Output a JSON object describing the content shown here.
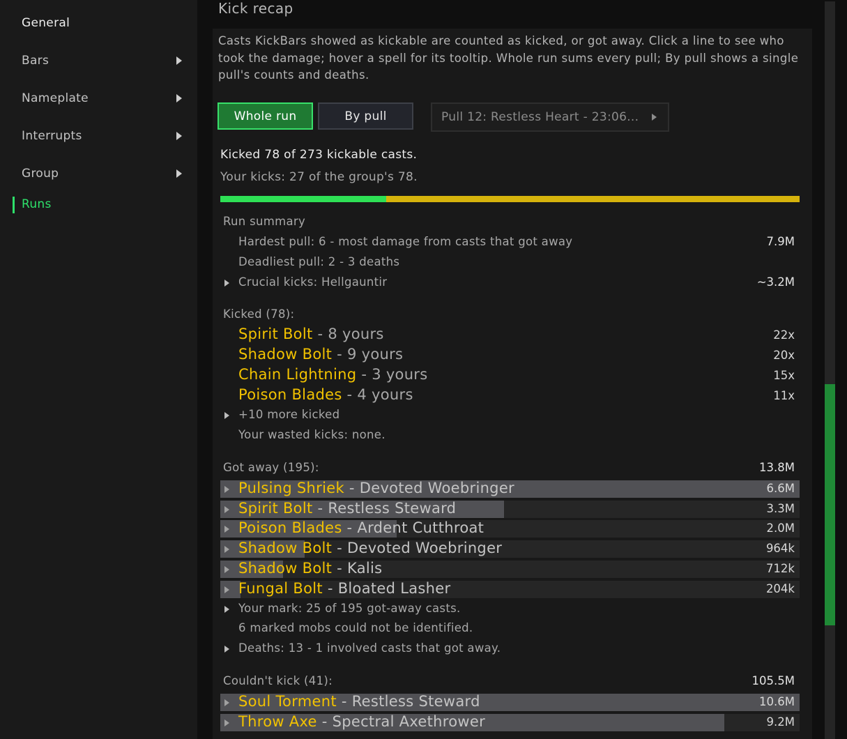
{
  "sidebar": {
    "items": [
      {
        "label": "General",
        "has_arrow": false
      },
      {
        "label": "Bars",
        "has_arrow": true
      },
      {
        "label": "Nameplate",
        "has_arrow": true
      },
      {
        "label": "Interrupts",
        "has_arrow": true
      },
      {
        "label": "Group",
        "has_arrow": true
      },
      {
        "label": "Runs",
        "has_arrow": false,
        "active": true
      }
    ]
  },
  "header": {
    "title": "Kick recap"
  },
  "description": "Casts KickBars showed as kickable are counted as kicked, or got away. Click a line to see who took the damage; hover a spell for its tooltip. Whole run sums every pull; By pull shows a single pull's counts and deaths.",
  "mode": {
    "whole_run": "Whole run",
    "by_pull": "By pull",
    "selected": "Whole run",
    "pull_select": "Pull 12: Restless Heart - 23:06..."
  },
  "totals": {
    "kicked_text": "Kicked 78 of 273 kickable casts.",
    "your_kicks_text": "Your kicks: 27 of the group's 78.",
    "progress_fraction": 0.286
  },
  "run_summary": {
    "title": "Run summary",
    "hardest": {
      "label": "Hardest pull: 6 - most damage from casts that got away",
      "value": "7.9M"
    },
    "deadliest": {
      "label": "Deadliest pull: 2 - 3 deaths"
    },
    "crucial": {
      "label": "Crucial kicks: Hellgauntir",
      "value": "~3.2M"
    }
  },
  "kicked": {
    "title": "Kicked (78):",
    "items": [
      {
        "spell": "Spirit Bolt",
        "detail": " - 8 yours",
        "count": "22x"
      },
      {
        "spell": "Shadow Bolt",
        "detail": " - 9 yours",
        "count": "20x"
      },
      {
        "spell": "Chain Lightning",
        "detail": " - 3 yours",
        "count": "15x"
      },
      {
        "spell": "Poison Blades",
        "detail": " - 4 yours",
        "count": "11x"
      }
    ],
    "more": "+10 more kicked",
    "wasted": "Your wasted kicks: none."
  },
  "got_away": {
    "title": "Got away (195):",
    "total": "13.8M",
    "items": [
      {
        "spell": "Pulsing Shriek",
        "detail": " - Devoted Woebringer",
        "value": "6.6M",
        "fraction": 1.0
      },
      {
        "spell": "Spirit Bolt",
        "detail": " - Restless Steward",
        "value": "3.3M",
        "fraction": 0.49
      },
      {
        "spell": "Poison Blades",
        "detail": " - Ardent Cutthroat",
        "value": "2.0M",
        "fraction": 0.304
      },
      {
        "spell": "Shadow Bolt",
        "detail": " - Devoted Woebringer",
        "value": "964k",
        "fraction": 0.146
      },
      {
        "spell": "Shadow Bolt",
        "detail": " - Kalis",
        "value": "712k",
        "fraction": 0.108
      },
      {
        "spell": "Fungal Bolt",
        "detail": " - Bloated Lasher",
        "value": "204k",
        "fraction": 0.031
      }
    ],
    "your_mark": "Your mark: 25 of 195 got-away casts.",
    "unidentified": "6 marked mobs could not be identified.",
    "deaths": "Deaths: 13 - 1 involved casts that got away."
  },
  "couldnt_kick": {
    "title": "Couldn't kick (41):",
    "total": "105.5M",
    "items": [
      {
        "spell": "Soul Torment",
        "detail": " - Restless Steward",
        "value": "10.6M",
        "fraction": 1.0
      },
      {
        "spell": "Throw Axe",
        "detail": " - Spectral Axethrower",
        "value": "9.2M",
        "fraction": 0.87
      }
    ]
  },
  "colors": {
    "accent_green": "#2ee06a",
    "spell_yellow": "#f2c200",
    "progress_yellow": "#d6b30c"
  }
}
